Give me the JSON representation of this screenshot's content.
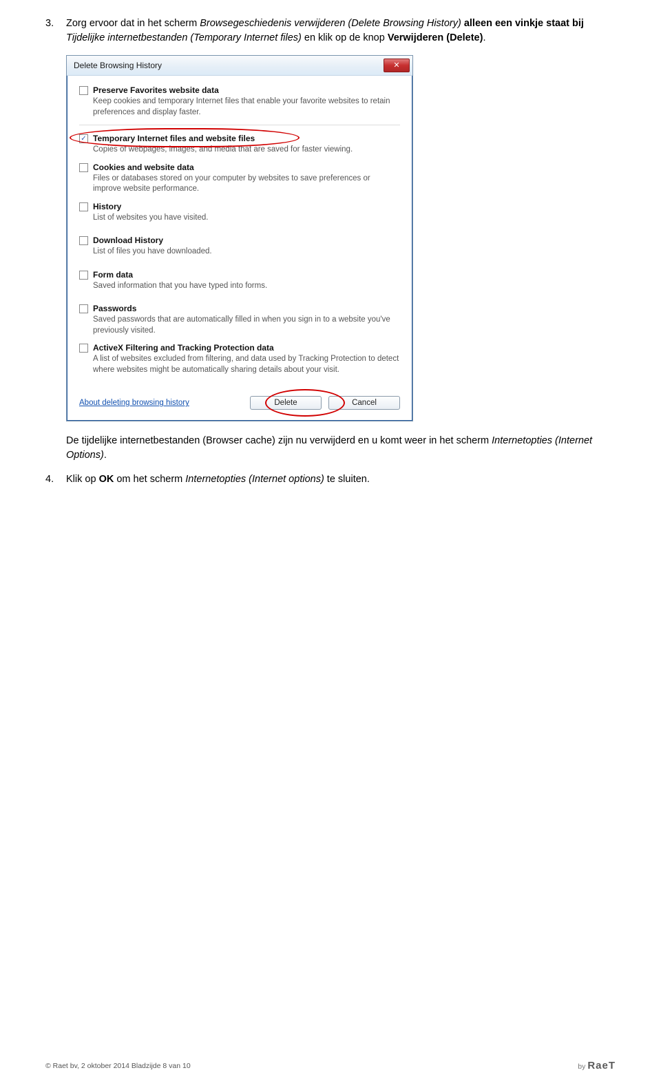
{
  "steps": {
    "s3_num": "3.",
    "s3_text_a": "Zorg ervoor dat in het scherm ",
    "s3_text_b": "Browsegeschiedenis verwijderen (Delete Browsing History)",
    "s3_text_c": " alleen een vinkje staat bij ",
    "s3_text_d": "Tijdelijke internetbestanden (Temporary Internet files)",
    "s3_text_e": " en klik op de knop ",
    "s3_text_f": "Verwijderen (Delete)",
    "s3_text_g": ".",
    "result_a": "De tijdelijke internetbestanden (Browser cache) zijn nu verwijderd en u komt weer in het scherm ",
    "result_b": "Internetopties (Internet Options)",
    "result_c": ".",
    "s4_num": "4.",
    "s4_text_a": "Klik op ",
    "s4_text_b": "OK",
    "s4_text_c": " om het scherm ",
    "s4_text_d": "Internetopties (Internet options)",
    "s4_text_e": " te sluiten."
  },
  "dialog": {
    "title": "Delete Browsing History",
    "close_glyph": "✕",
    "options": [
      {
        "checked": false,
        "label": "Preserve Favorites website data",
        "desc": "Keep cookies and temporary Internet files that enable your favorite websites to retain preferences and display faster."
      },
      {
        "checked": true,
        "label": "Temporary Internet files and website files",
        "desc": "Copies of webpages, images, and media that are saved for faster viewing."
      },
      {
        "checked": false,
        "label": "Cookies and website data",
        "desc": "Files or databases stored on your computer by websites to save preferences or improve website performance."
      },
      {
        "checked": false,
        "label": "History",
        "desc": "List of websites you have visited."
      },
      {
        "checked": false,
        "label": "Download History",
        "desc": "List of files you have downloaded."
      },
      {
        "checked": false,
        "label": "Form data",
        "desc": "Saved information that you have typed into forms."
      },
      {
        "checked": false,
        "label": "Passwords",
        "desc": "Saved passwords that are automatically filled in when you sign in to a website you've previously visited."
      },
      {
        "checked": false,
        "label": "ActiveX Filtering and Tracking Protection data",
        "desc": "A list of websites excluded from filtering, and data used by Tracking Protection to detect where websites might be automatically sharing details about your visit."
      }
    ],
    "link": "About deleting browsing history",
    "delete_btn": "Delete",
    "cancel_btn": "Cancel"
  },
  "footer": {
    "left": "© Raet bv, 2 oktober 2014 Bladzijde 8 van 10",
    "by": "by",
    "brand": "RaeT"
  }
}
